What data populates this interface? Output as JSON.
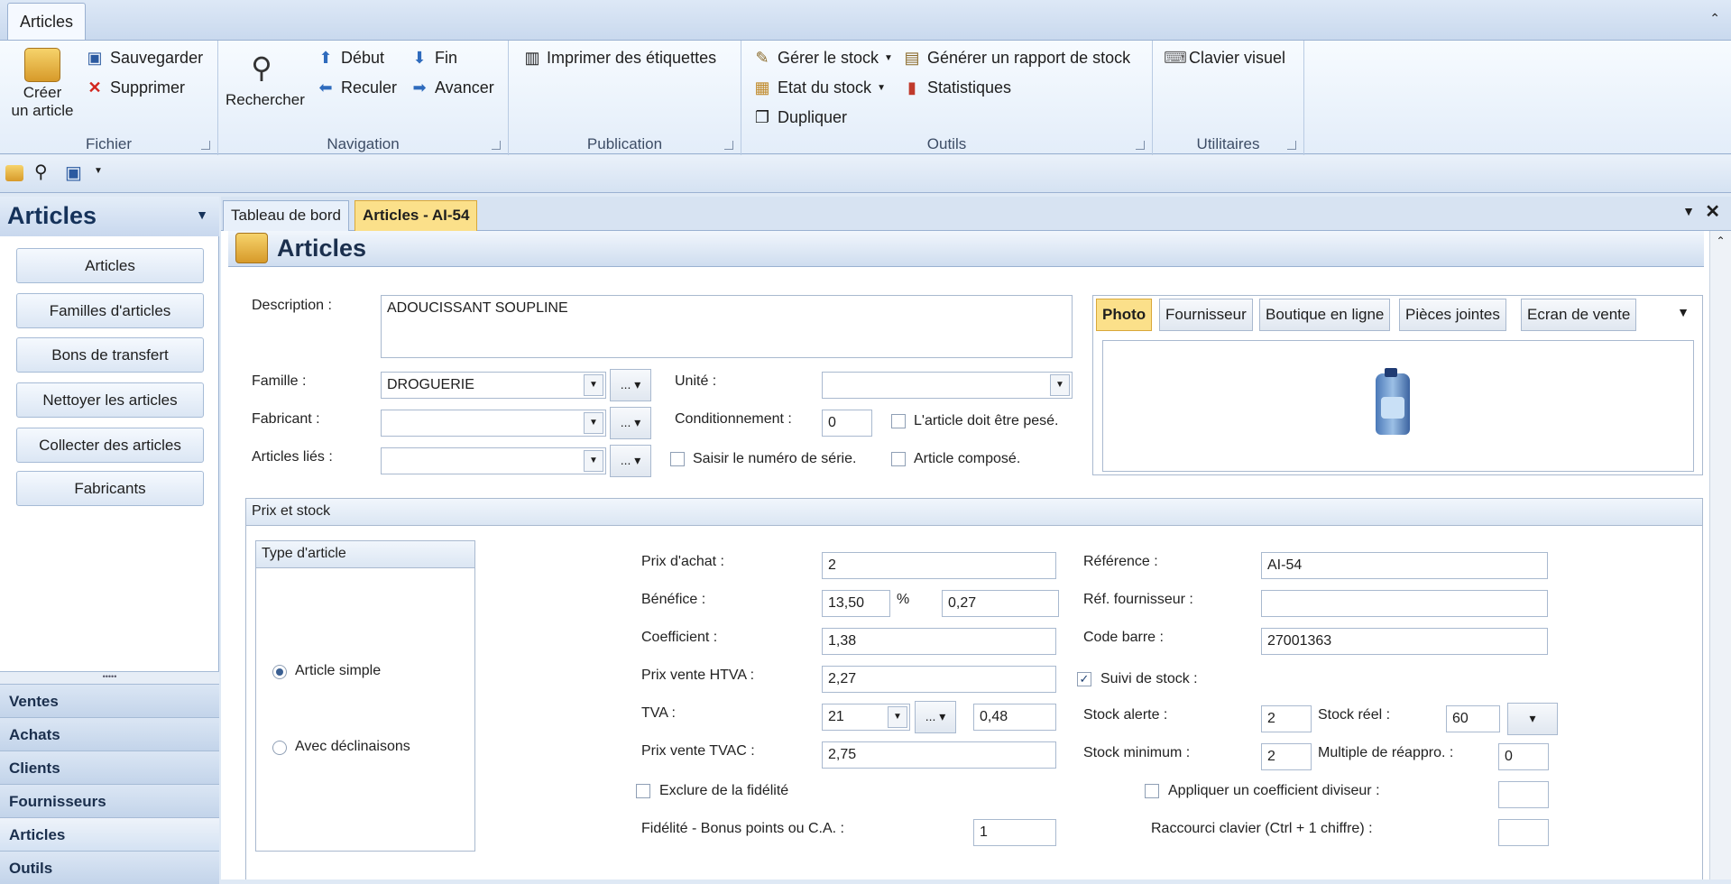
{
  "ribbon": {
    "tab": "Articles",
    "collapse_icon": "chevron-up-icon",
    "fichier": {
      "label": "Fichier",
      "create_line1": "Créer",
      "create_line2": "un article",
      "save": "Sauvegarder",
      "delete": "Supprimer"
    },
    "navigation": {
      "label": "Navigation",
      "search": "Rechercher",
      "start": "Début",
      "end": "Fin",
      "back": "Reculer",
      "forward": "Avancer"
    },
    "publication": {
      "label": "Publication",
      "print_labels": "Imprimer des étiquettes"
    },
    "outils": {
      "label": "Outils",
      "manage_stock": "Gérer le stock",
      "stock_state": "Etat du stock",
      "duplicate": "Dupliquer",
      "stock_report": "Générer un rapport de stock",
      "statistics": "Statistiques"
    },
    "utilitaires": {
      "label": "Utilitaires",
      "keyboard": "Clavier visuel"
    }
  },
  "left": {
    "title": "Articles",
    "buttons": [
      "Articles",
      "Familles d'articles",
      "Bons de transfert",
      "Nettoyer les articles",
      "Collecter des articles",
      "Fabricants"
    ],
    "grip": "•••••",
    "nav": [
      "Ventes",
      "Achats",
      "Clients",
      "Fournisseurs",
      "Articles",
      "Outils"
    ]
  },
  "doctabs": [
    "Tableau de bord",
    "Articles - AI-54"
  ],
  "main": {
    "title": "Articles",
    "description_label": "Description :",
    "description": "ADOUCISSANT SOUPLINE",
    "famille_label": "Famille :",
    "famille": "DROGUERIE",
    "fabricant_label": "Fabricant :",
    "fabricant": "",
    "lies_label": "Articles liés :",
    "lies": "",
    "unite_label": "Unité :",
    "unite": "",
    "cond_label": "Conditionnement :",
    "cond": "0",
    "pese_label": "L'article doit être pesé.",
    "serie_label": "Saisir le numéro de série.",
    "compose_label": "Article composé.",
    "photo_tabs": [
      "Photo",
      "Fournisseur",
      "Boutique en ligne",
      "Pièces jointes",
      "Ecran de vente"
    ],
    "prix_section": "Prix et stock",
    "type_title": "Type d'article",
    "type_simple": "Article simple",
    "type_decl": "Avec déclinaisons",
    "achat_label": "Prix d'achat :",
    "achat": "2",
    "benefice_label": "Bénéfice :",
    "benefice_pct": "13,50",
    "pct_sign": "%",
    "benefice_val": "0,27",
    "coef_label": "Coefficient :",
    "coef": "1,38",
    "htva_label": "Prix vente HTVA :",
    "htva": "2,27",
    "tva_label": "TVA :",
    "tva": "21",
    "tva_val": "0,48",
    "tvac_label": "Prix vente TVAC :",
    "tvac": "2,75",
    "exclure_label": "Exclure de la fidélité",
    "fidelite_label": "Fidélité - Bonus points ou C.A. :",
    "fidelite": "1",
    "ref_label": "Référence :",
    "ref": "AI-54",
    "reffour_label": "Réf. fournisseur :",
    "reffour": "",
    "barre_label": "Code barre :",
    "barre": "27001363",
    "suivi_label": "Suivi de stock :",
    "alerte_label": "Stock alerte :",
    "alerte": "2",
    "reel_label": "Stock réel :",
    "reel": "60",
    "min_label": "Stock minimum :",
    "min": "2",
    "multiple_label": "Multiple de réappro. :",
    "multiple": "0",
    "coefdiv_label": "Appliquer un coefficient diviseur :",
    "raccourci_label": "Raccourci clavier  (Ctrl + 1 chiffre) :"
  }
}
